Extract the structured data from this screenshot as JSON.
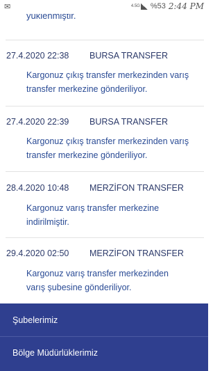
{
  "status_bar": {
    "network": "4.5G",
    "battery": "%53",
    "time": "2:44 PM"
  },
  "previous_entry_tail": "yüklenmiştir.",
  "entries": [
    {
      "date": "27.4.2020 22:38",
      "location": "BURSA TRANSFER",
      "message_lines": [
        "Kargonuz çıkış transfer merkezinden varış",
        "transfer merkezine gönderiliyor."
      ]
    },
    {
      "date": "27.4.2020 22:39",
      "location": "BURSA TRANSFER",
      "message_lines": [
        "Kargonuz çıkış transfer merkezinden varış",
        "transfer merkezine gönderiliyor."
      ]
    },
    {
      "date": "28.4.2020 10:48",
      "location": "MERZİFON TRANSFER",
      "message_lines": [
        "Kargonuz varış transfer merkezine",
        "indirilmiştir."
      ]
    },
    {
      "date": "29.4.2020 02:50",
      "location": "MERZİFON TRANSFER",
      "message_lines": [
        "Kargonuz varış transfer merkezinden",
        "varış şubesine gönderiliyor."
      ]
    }
  ],
  "menu": {
    "items": [
      {
        "label": "Şubelerimiz"
      },
      {
        "label": "Bölge Müdürlüklerimiz"
      }
    ]
  }
}
